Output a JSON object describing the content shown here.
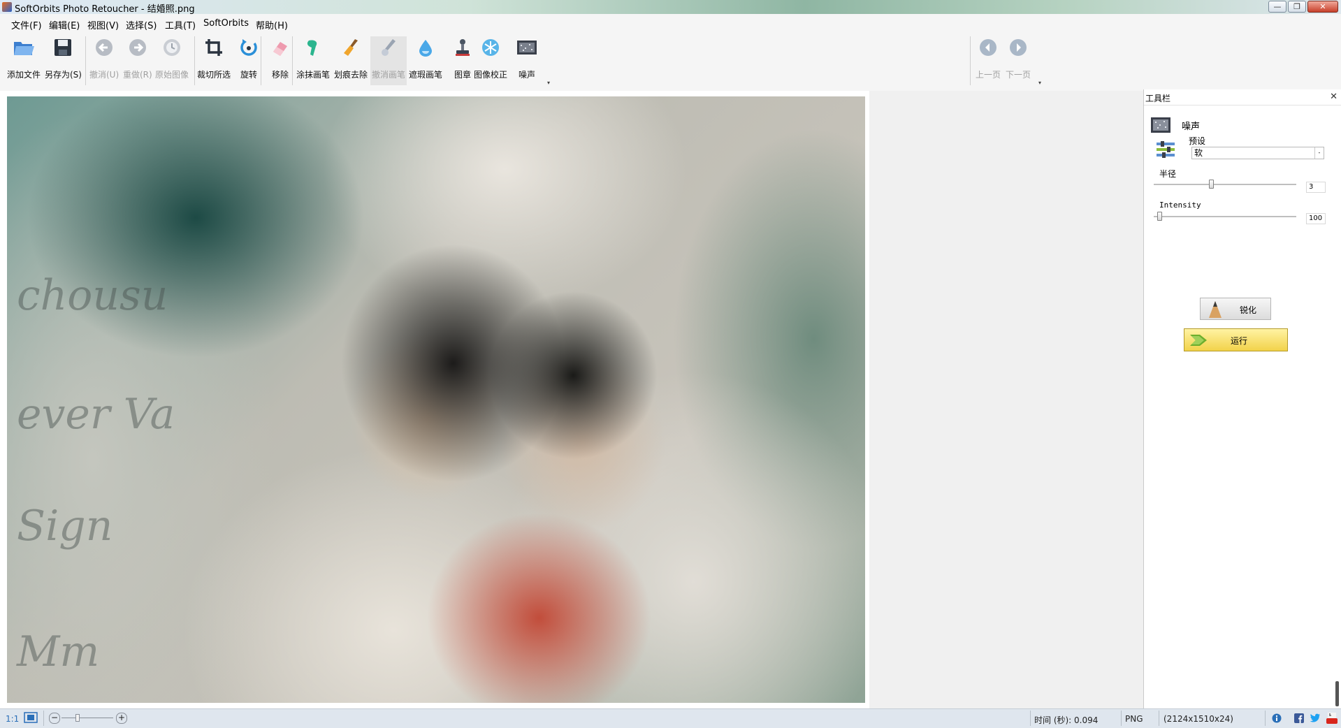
{
  "window": {
    "title": "SoftOrbits Photo Retoucher - 结婚照.png",
    "minimize_label": "—",
    "maximize_label": "❐",
    "close_label": "✕"
  },
  "menu": {
    "items": [
      "文件(F)",
      "编辑(E)",
      "视图(V)",
      "选择(S)",
      "工具(T)",
      "SoftOrbits",
      "帮助(H)"
    ]
  },
  "toolbar": {
    "add_file": "添加文件",
    "save_as": "另存为(S)",
    "undo": "撤消(U)",
    "redo": "重做(R)",
    "original": "原始图像",
    "crop": "裁切所选",
    "rotate": "旋转",
    "remove": "移除",
    "smudge": "涂抹画笔",
    "scratch": "划痕去除",
    "cancel_brush": "撤消画笔",
    "mask_brush": "遮瑕画笔",
    "stamp": "图章",
    "correction": "图像校正",
    "noise": "噪声",
    "prev_page": "上一页",
    "next_page": "下一页",
    "more": "▾"
  },
  "panel": {
    "title": "工具栏",
    "close": "✕",
    "tool_name": "噪声",
    "preset_label": "预设",
    "preset_value": "软",
    "preset_arrow": "-",
    "radius_label": "半径",
    "radius_value": "3",
    "radius_fraction": 0.4,
    "intensity_label": "Intensity",
    "intensity_value": "100",
    "intensity_fraction": 0.04,
    "sharpen_label": "锐化",
    "run_label": "运行"
  },
  "status": {
    "zoom_1to1": "1:1",
    "time": "时间 (秒): 0.094",
    "format": "PNG",
    "dimensions": "(2124x1510x24)"
  },
  "colors": {
    "accent": "#2a7fd4",
    "run_button": "#f2d24a"
  }
}
